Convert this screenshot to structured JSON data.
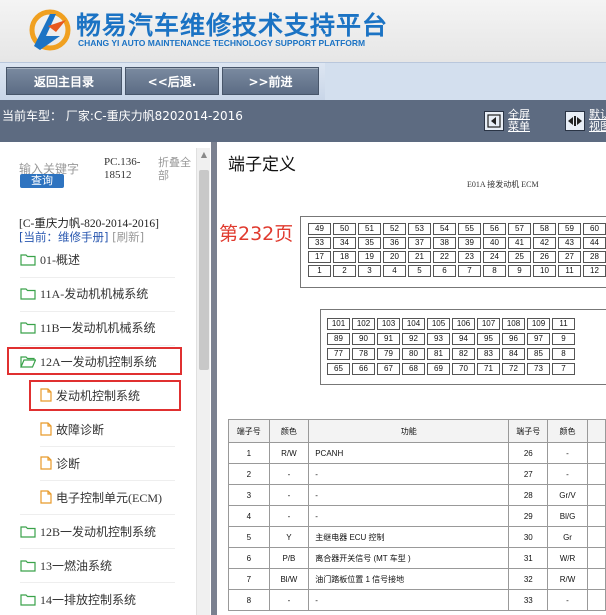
{
  "header": {
    "title": "畅易汽车维修技术支持平台",
    "subtitle": "CHANG YI AUTO MAINTENANCE TECHNOLOGY SUPPORT PLATFORM",
    "logo_color": "#1b73c4"
  },
  "nav": {
    "home_label": "返回主目录",
    "back_label": "<<后退.",
    "forward_label": ">>前进"
  },
  "model_bar": {
    "current_model": "当前车型： 厂家:C-重庆力帆8202014-2016",
    "fullscreen_line1": "全屏",
    "fullscreen_line2": "菜单",
    "default_line1": "默认",
    "default_line2": "视图"
  },
  "sidebar": {
    "search_placeholder": "输入关键字",
    "search_button": "查询",
    "pc_code": "PC.136-18512",
    "collapse_all": "折叠全部",
    "model_info": "[C-重庆力帆-820-2014-2016]",
    "current_manual": "[当前：维修手册]",
    "refresh": "[刷新]",
    "items": [
      {
        "label": "01-概述",
        "type": "folder"
      },
      {
        "label": "11A-发动机机械系统",
        "type": "folder"
      },
      {
        "label": "11B一发动机机械系统",
        "type": "folder"
      },
      {
        "label": "12A一发动机控制系统",
        "type": "folder-open"
      },
      {
        "label": "发动机控制系统",
        "type": "doc"
      },
      {
        "label": "故障诊断",
        "type": "doc"
      },
      {
        "label": "诊断",
        "type": "doc"
      },
      {
        "label": "电子控制单元(ECM)",
        "type": "doc"
      },
      {
        "label": "12B一发动机控制系统",
        "type": "folder"
      },
      {
        "label": "13一燃油系统",
        "type": "folder"
      },
      {
        "label": "14一排放控制系统",
        "type": "folder"
      }
    ]
  },
  "main": {
    "title": "端子定义",
    "page_number": "第232页",
    "diagram_caption": "E01A 接发动机 ECM",
    "connector_a": [
      [
        "49",
        "50",
        "51",
        "52",
        "53",
        "54",
        "55",
        "56",
        "57",
        "58",
        "59",
        "60"
      ],
      [
        "33",
        "34",
        "35",
        "36",
        "37",
        "38",
        "39",
        "40",
        "41",
        "42",
        "43",
        "44"
      ],
      [
        "17",
        "18",
        "19",
        "20",
        "21",
        "22",
        "23",
        "24",
        "25",
        "26",
        "27",
        "28"
      ],
      [
        "1",
        "2",
        "3",
        "4",
        "5",
        "6",
        "7",
        "8",
        "9",
        "10",
        "11",
        "12"
      ]
    ],
    "connector_b": [
      [
        "101",
        "102",
        "103",
        "104",
        "105",
        "106",
        "107",
        "108",
        "109",
        "11"
      ],
      [
        "89",
        "90",
        "91",
        "92",
        "93",
        "94",
        "95",
        "96",
        "97",
        "9"
      ],
      [
        "77",
        "78",
        "79",
        "80",
        "81",
        "82",
        "83",
        "84",
        "85",
        "8"
      ],
      [
        "65",
        "66",
        "67",
        "68",
        "69",
        "70",
        "71",
        "72",
        "73",
        "7"
      ]
    ],
    "table": {
      "headers": [
        "端子号",
        "颜色",
        "功能",
        "端子号",
        "颜色"
      ],
      "rows": [
        [
          "1",
          "R/W",
          "PCANH",
          "26",
          "-"
        ],
        [
          "2",
          "-",
          "-",
          "27",
          "-"
        ],
        [
          "3",
          "-",
          "-",
          "28",
          "Gr/V"
        ],
        [
          "4",
          "-",
          "-",
          "29",
          "Bl/G"
        ],
        [
          "5",
          "Y",
          "主继电器 ECU 控制",
          "30",
          "Gr"
        ],
        [
          "6",
          "P/B",
          "离合器开关信号 (MT 车型 )",
          "31",
          "W/R"
        ],
        [
          "7",
          "Bl/W",
          "油门踏板位置 1 信号接地",
          "32",
          "R/W"
        ],
        [
          "8",
          "-",
          "-",
          "33",
          "-"
        ]
      ]
    }
  }
}
